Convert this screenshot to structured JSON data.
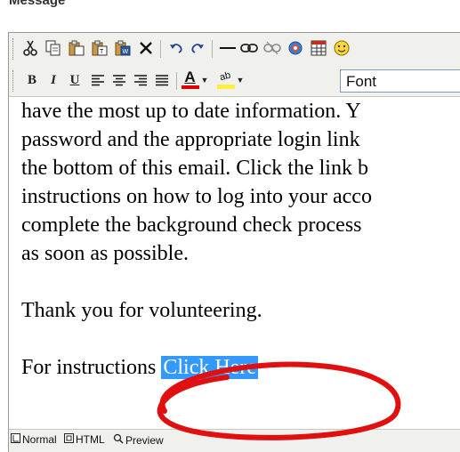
{
  "field": {
    "label": "Message"
  },
  "toolbar": {
    "font_select_value": "Font",
    "font_color_letter": "A",
    "highlight_letters": "ab",
    "bold_glyph": "B",
    "italic_glyph": "I",
    "underline_glyph": "U",
    "icons": [
      "cut-icon",
      "copy-icon",
      "paste-icon",
      "paste-text-icon",
      "paste-word-icon",
      "delete-icon",
      "undo-icon",
      "redo-icon",
      "horizontal-rule-icon",
      "link-icon",
      "unlink-icon",
      "anchor-icon",
      "table-icon",
      "smiley-icon",
      "bold-icon",
      "italic-icon",
      "underline-icon",
      "align-left-icon",
      "align-center-icon",
      "align-right-icon",
      "justify-icon",
      "font-color-icon",
      "highlight-color-icon"
    ]
  },
  "content": {
    "lines": [
      "have the most up to date information. Y",
      "password and the appropriate login link",
      "the bottom of this email. Click the link b",
      "instructions on how to log into your acco",
      "complete the background check process",
      "as soon as possible."
    ],
    "thanks": "Thank you for volunteering.",
    "instructions_prefix": "For instructions ",
    "link_text": "Click Here"
  },
  "modes": {
    "normal": "Normal",
    "html": "HTML",
    "preview": "Preview"
  },
  "colors": {
    "selection": "#3399ff",
    "annotation": "#e01010",
    "toolbar_bg": "#f0f0ec"
  }
}
